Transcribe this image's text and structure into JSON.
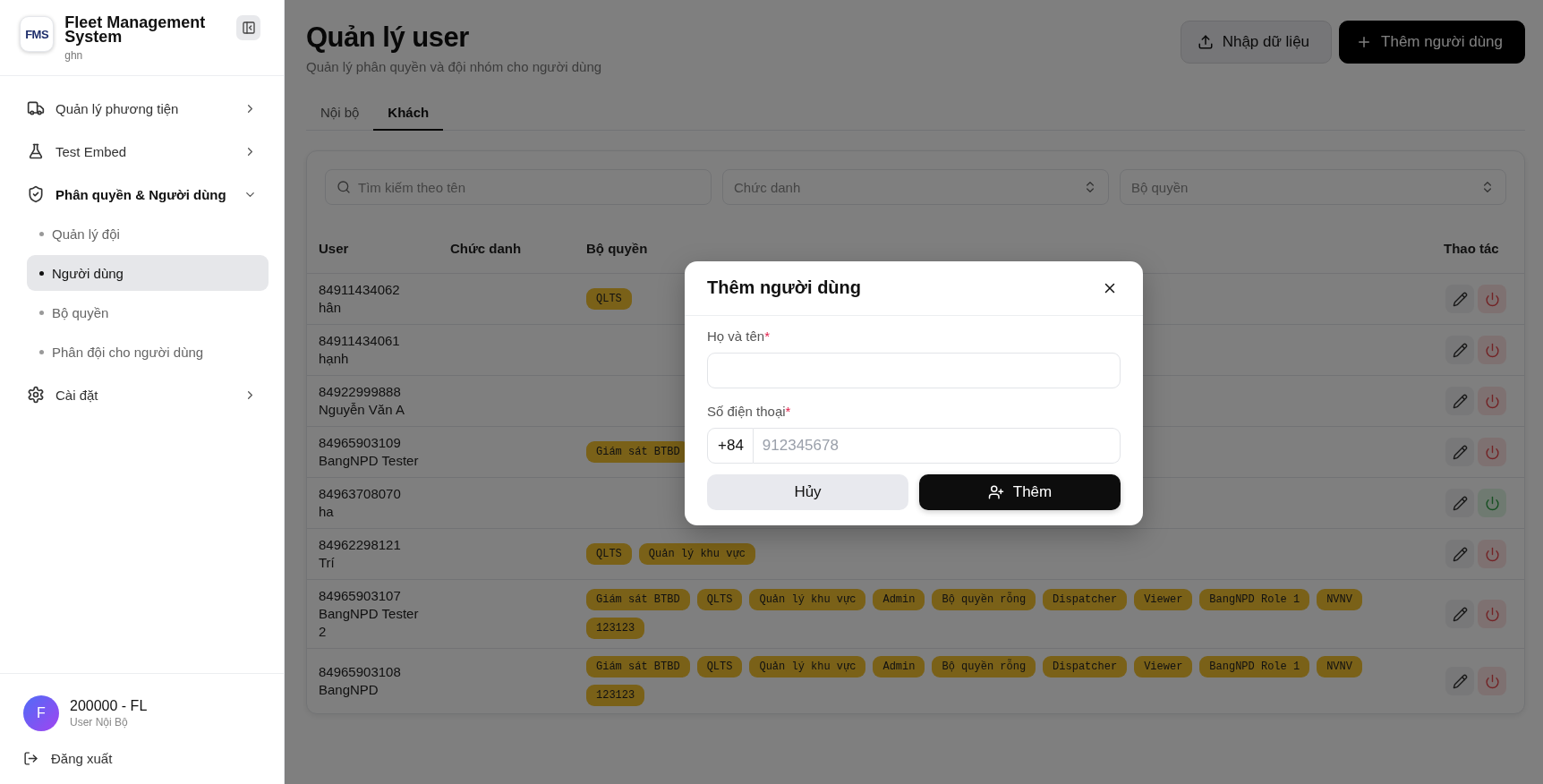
{
  "sidebar": {
    "logo": "FMS",
    "app_name": "Fleet Management System",
    "org": "ghn",
    "items": [
      {
        "label": "Quản lý phương tiện",
        "kind": "truck",
        "expanded": false
      },
      {
        "label": "Test Embed",
        "kind": "flask",
        "expanded": false
      },
      {
        "label": "Phân quyền & Người dùng",
        "kind": "shield",
        "expanded": true,
        "children": [
          {
            "label": "Quản lý đội",
            "selected": false
          },
          {
            "label": "Người dùng",
            "selected": true
          },
          {
            "label": "Bộ quyền",
            "selected": false
          },
          {
            "label": "Phân đội cho người dùng",
            "selected": false
          }
        ]
      },
      {
        "label": "Cài đặt",
        "kind": "gear",
        "expanded": false
      }
    ],
    "user": {
      "initial": "F",
      "name": "200000 - FL",
      "role": "User Nội Bộ"
    },
    "logout": "Đăng xuất"
  },
  "header": {
    "title": "Quản lý user",
    "subtitle": "Quản lý phân quyền và đội nhóm cho người dùng",
    "buttons": [
      {
        "label": "Nhập dữ liệu",
        "kind": "upload"
      },
      {
        "label": "Thêm người dùng",
        "kind": "add"
      }
    ]
  },
  "tabs": [
    {
      "label": "Nội bộ",
      "selected": false
    },
    {
      "label": "Khách",
      "selected": true
    }
  ],
  "filters": {
    "search": {
      "placeholder": "Tìm kiếm theo tên"
    },
    "selects": [
      {
        "placeholder": "Chức danh"
      },
      {
        "placeholder": "Bộ quyền"
      }
    ]
  },
  "table": {
    "columns": [
      "User",
      "Chức danh",
      "Bộ quyền",
      "Thao tác"
    ],
    "rows": [
      {
        "phone": "84911434062",
        "name": "hân",
        "roles": [
          "QLTS"
        ],
        "active": true
      },
      {
        "phone": "84911434061",
        "name": "hạnh",
        "roles": [],
        "active": true
      },
      {
        "phone": "84922999888",
        "name": "Nguyễn Văn A",
        "roles": [],
        "active": true
      },
      {
        "phone": "84965903109",
        "name": "BangNPD Tester",
        "roles": [
          "Giám sát BTBD"
        ],
        "active": true
      },
      {
        "phone": "84963708070",
        "name": "ha",
        "roles": [],
        "active": false
      },
      {
        "phone": "84962298121",
        "name": "Trí",
        "roles": [
          "QLTS",
          "Quản lý khu vực"
        ],
        "active": true
      },
      {
        "phone": "84965903107",
        "name": "BangNPD Tester 2",
        "roles": [
          "Giám sát BTBD",
          "QLTS",
          "Quản lý khu vực",
          "Admin",
          "Bộ quyền rỗng",
          "Dispatcher",
          "Viewer",
          "BangNPD Role 1",
          "NVNV",
          "123123"
        ],
        "active": true
      },
      {
        "phone": "84965903108",
        "name": "BangNPD",
        "roles": [
          "Giám sát BTBD",
          "QLTS",
          "Quản lý khu vực",
          "Admin",
          "Bộ quyền rỗng",
          "Dispatcher",
          "Viewer",
          "BangNPD Role 1",
          "NVNV",
          "123123"
        ],
        "active": true
      }
    ]
  },
  "dialog": {
    "title": "Thêm người dùng",
    "fields": [
      {
        "label": "Họ và tên",
        "required_mark": "*",
        "kind": "text"
      },
      {
        "label": "Số điện thoại",
        "required_mark": "*",
        "kind": "phone",
        "prefix": "+84",
        "placeholder": "912345678"
      }
    ],
    "buttons": [
      {
        "label": "Hủy",
        "kind": "cancel"
      },
      {
        "label": "Thêm",
        "kind": "confirm"
      }
    ]
  }
}
